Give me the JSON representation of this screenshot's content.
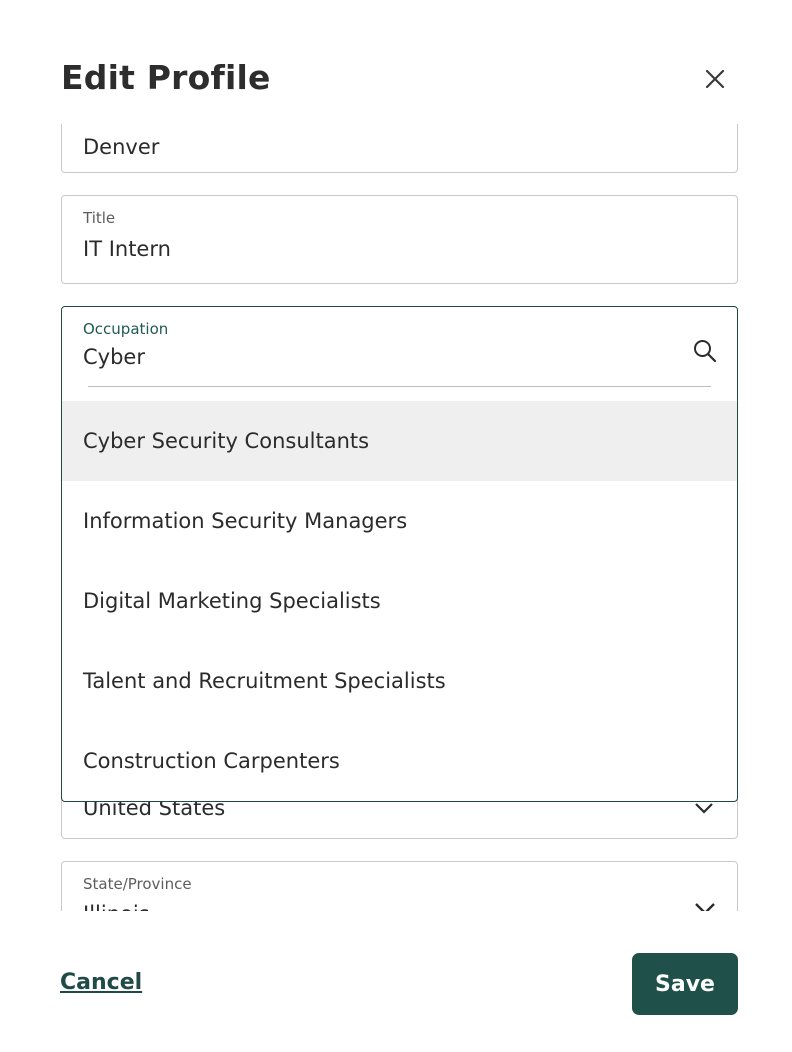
{
  "header": {
    "title": "Edit Profile",
    "close_icon": "close-icon"
  },
  "form": {
    "city": {
      "value": "Denver"
    },
    "title_field": {
      "label": "Title",
      "value": "IT Intern"
    },
    "occupation": {
      "label": "Occupation",
      "search_value": "Cyber",
      "search_icon": "search-icon",
      "options": [
        "Cyber Security Consultants",
        "Information Security Managers",
        "Digital Marketing Specialists",
        "Talent and Recruitment Specialists",
        "Construction Carpenters"
      ],
      "highlighted_index": 0
    },
    "country": {
      "value": "United States",
      "icon": "chevron-down-icon"
    },
    "state": {
      "label": "State/Province",
      "value": "Illinois",
      "icon": "chevron-down-icon"
    }
  },
  "footer": {
    "cancel_label": "Cancel",
    "save_label": "Save"
  },
  "colors": {
    "accent": "#1f514a",
    "option_highlight": "#efefef",
    "border": "#c9c9c9"
  }
}
